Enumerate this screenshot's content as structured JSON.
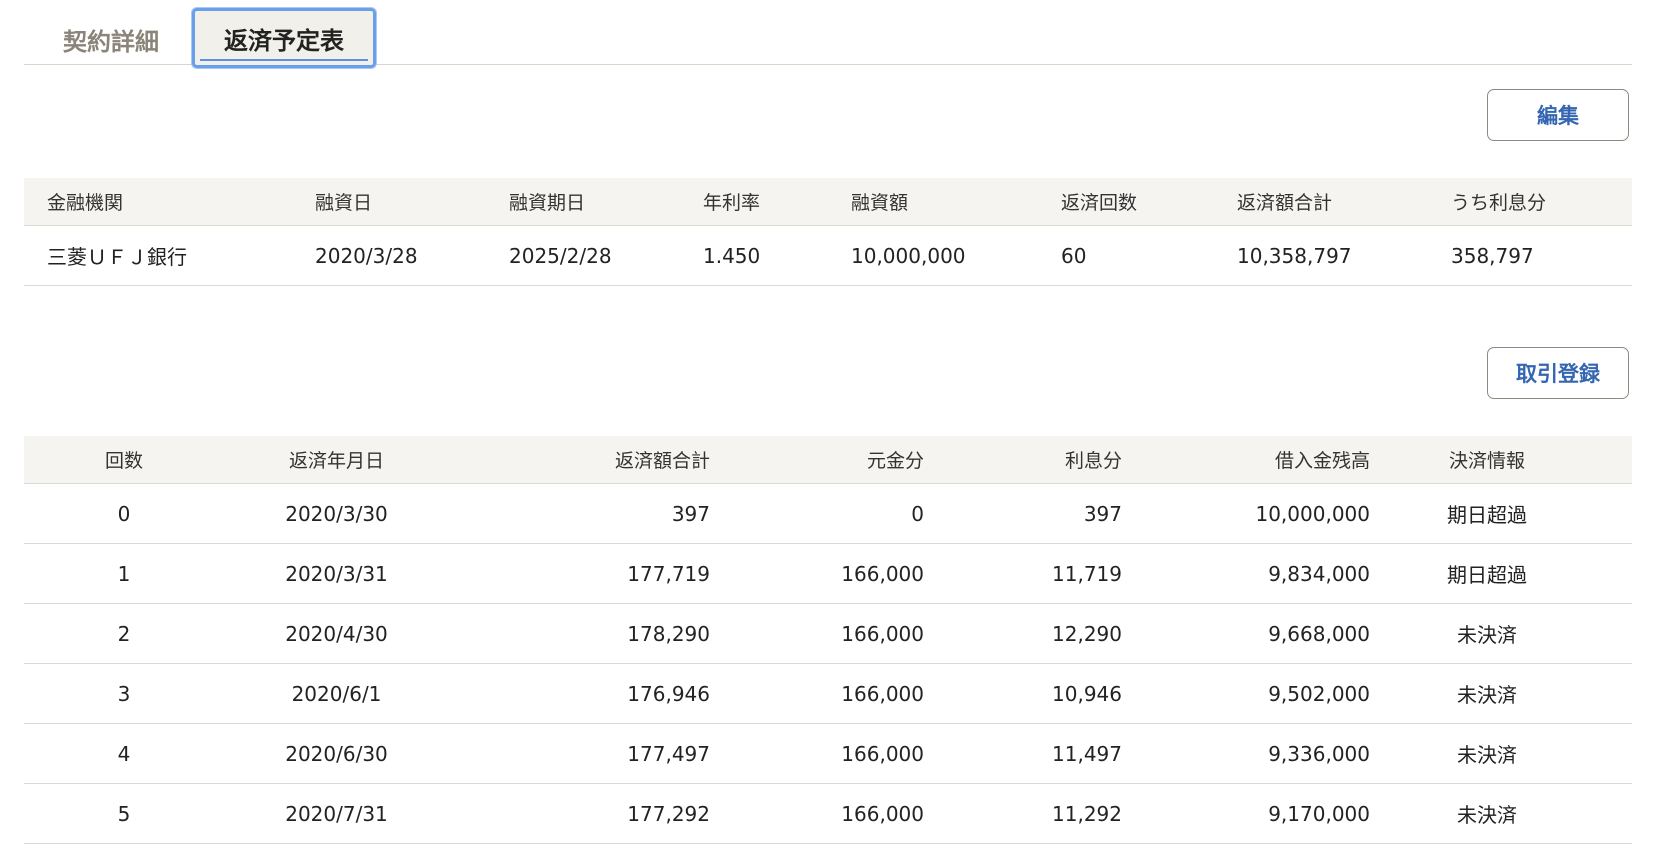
{
  "tabs": [
    {
      "label": "契約詳細",
      "active": false
    },
    {
      "label": "返済予定表",
      "active": true
    }
  ],
  "buttons": {
    "edit": "編集",
    "register": "取引登録"
  },
  "loan_table": {
    "headers": {
      "bank": "金融機関",
      "loan_date": "融資日",
      "due_date": "融資期日",
      "rate": "年利率",
      "amount": "融資額",
      "count": "返済回数",
      "total": "返済額合計",
      "interest": "うち利息分"
    },
    "row": {
      "bank": "三菱ＵＦＪ銀行",
      "loan_date": "2020/3/28",
      "due_date": "2025/2/28",
      "rate": "1.450",
      "amount": "10,000,000",
      "count": "60",
      "total": "10,358,797",
      "interest": "358,797"
    }
  },
  "schedule": {
    "headers": {
      "no": "回数",
      "date": "返済年月日",
      "total": "返済額合計",
      "principal": "元金分",
      "interest": "利息分",
      "balance": "借入金残高",
      "status": "決済情報"
    },
    "rows": [
      {
        "no": "0",
        "date": "2020/3/30",
        "total": "397",
        "principal": "0",
        "interest": "397",
        "balance": "10,000,000",
        "status": "期日超過"
      },
      {
        "no": "1",
        "date": "2020/3/31",
        "total": "177,719",
        "principal": "166,000",
        "interest": "11,719",
        "balance": "9,834,000",
        "status": "期日超過"
      },
      {
        "no": "2",
        "date": "2020/4/30",
        "total": "178,290",
        "principal": "166,000",
        "interest": "12,290",
        "balance": "9,668,000",
        "status": "未決済"
      },
      {
        "no": "3",
        "date": "2020/6/1",
        "total": "176,946",
        "principal": "166,000",
        "interest": "10,946",
        "balance": "9,502,000",
        "status": "未決済"
      },
      {
        "no": "4",
        "date": "2020/6/30",
        "total": "177,497",
        "principal": "166,000",
        "interest": "11,497",
        "balance": "9,336,000",
        "status": "未決済"
      },
      {
        "no": "5",
        "date": "2020/7/31",
        "total": "177,292",
        "principal": "166,000",
        "interest": "11,292",
        "balance": "9,170,000",
        "status": "未決済"
      }
    ]
  }
}
